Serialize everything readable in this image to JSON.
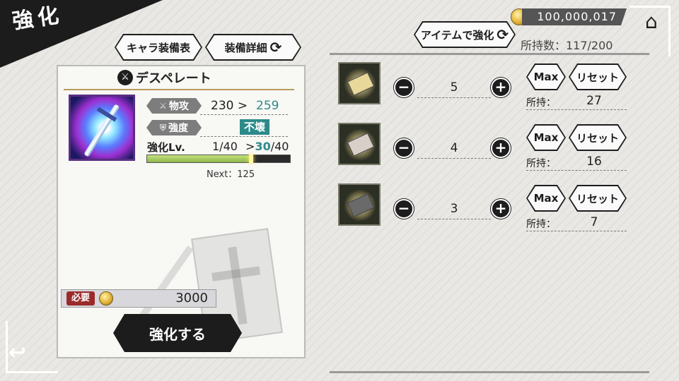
{
  "screen_title": "強化",
  "currency": {
    "amount": "100,000,017",
    "icon": "coin-icon"
  },
  "tabs": {
    "char_equip": "キャラ装備表",
    "equip_detail": "装備詳細"
  },
  "item_enhance_button": "アイテムで強化",
  "holdings": "所持数：117/200",
  "weapon": {
    "name": "デスペレート",
    "attack_label": "物攻",
    "attack_current": "230 >",
    "attack_next": "259",
    "durability_label": "強度",
    "durability_value": "不壊",
    "level_label": "強化Lv.",
    "level_current": "1/40",
    "level_arrow": ">",
    "level_next": "30",
    "level_max": "/40",
    "level_progress": 0.73,
    "next_label": "Next：125"
  },
  "cost": {
    "label": "必要",
    "value": "3000"
  },
  "enhance_button": "強化する",
  "items": [
    {
      "name": "whetstone-1",
      "quantity": "5",
      "max_label": "Max",
      "reset_label": "リセット",
      "owned_label": "所持：",
      "owned": "27",
      "color": "#e8d89a"
    },
    {
      "name": "whetstone-2",
      "quantity": "4",
      "max_label": "Max",
      "reset_label": "リセット",
      "owned_label": "所持：",
      "owned": "16",
      "color": "#d8cfc8"
    },
    {
      "name": "whetstone-3",
      "quantity": "3",
      "max_label": "Max",
      "reset_label": "リセット",
      "owned_label": "所持：",
      "owned": "7",
      "color": "#6a6a6a"
    }
  ],
  "icons": {
    "home": "home-icon",
    "back": "back-icon",
    "refresh": "refresh-icon",
    "minus": "minus-icon",
    "plus": "plus-icon"
  }
}
